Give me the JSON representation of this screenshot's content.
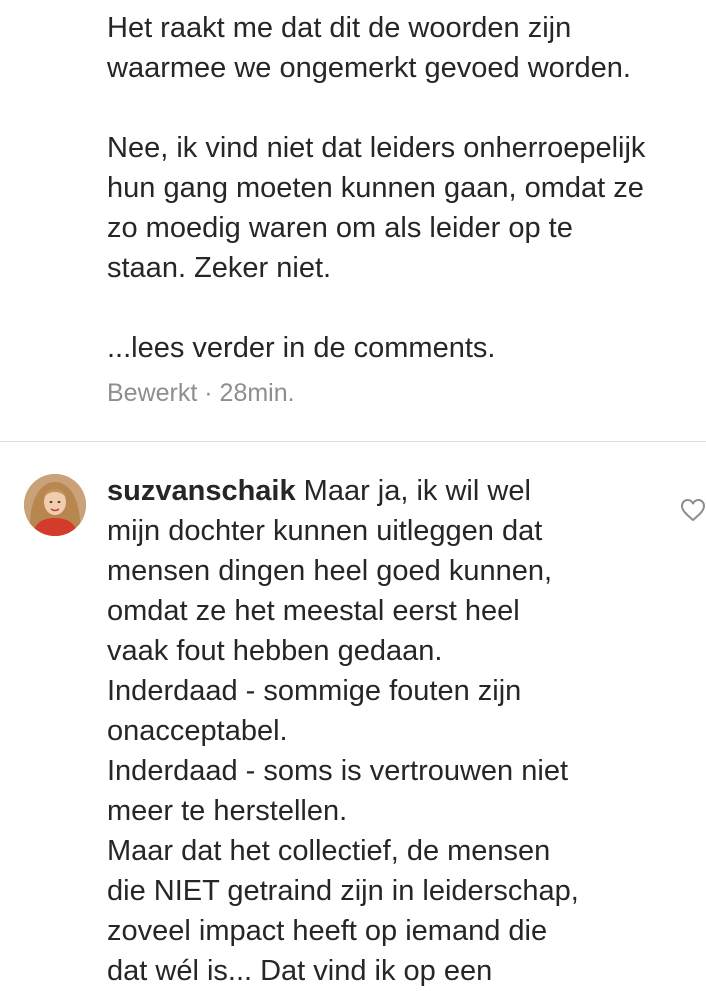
{
  "caption": {
    "paragraph1": [
      "Het raakt me dat dit de woorden zijn",
      "waarmee we ongemerkt gevoed worden."
    ],
    "paragraph2": [
      "Nee, ik vind niet dat leiders onherroepelijk",
      "hun gang moeten kunnen gaan, omdat ze",
      "zo moedig waren om als leider op te",
      "staan. Zeker niet."
    ],
    "read_more": "...lees verder in de comments.",
    "edited_label": "Bewerkt",
    "separator": "·",
    "time_ago": "28min."
  },
  "comment": {
    "username": "suzvanschaik",
    "first_line_rest": "Maar ja, ik wil wel",
    "lines": [
      "mijn dochter kunnen uitleggen dat",
      "mensen dingen heel goed kunnen,",
      "omdat ze het meestal eerst heel",
      "vaak fout hebben gedaan.",
      "Inderdaad - sommige fouten zijn",
      "onacceptabel.",
      "Inderdaad - soms is vertrouwen niet",
      "meer te herstellen.",
      "Maar dat het collectief, de mensen",
      "die NIET getraind zijn in leiderschap,",
      "zoveel impact heeft op iemand die",
      "dat wél is... Dat vind ik op een"
    ],
    "like_icon": "heart-outline-icon"
  },
  "colors": {
    "text": "#262626",
    "meta": "#8e8e8e",
    "divider": "#dbdbdb"
  }
}
